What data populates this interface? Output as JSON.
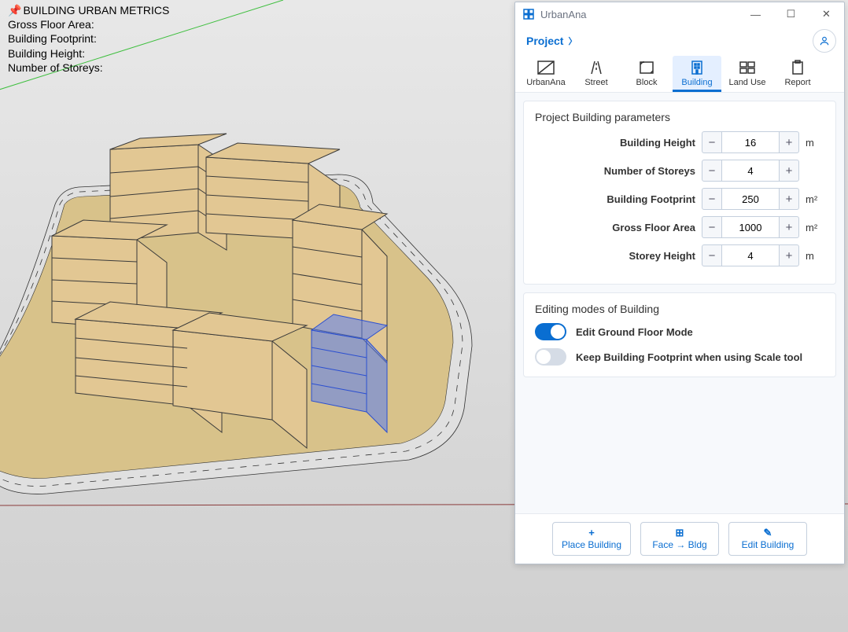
{
  "overlay": {
    "title": "BUILDING URBAN METRICS",
    "rows": [
      "Gross Floor Area:",
      "Building Footprint:",
      "Building Height:",
      "Number of Storeys:"
    ]
  },
  "panel": {
    "appName": "UrbanAna",
    "nav": {
      "project": "Project"
    },
    "tabs": [
      {
        "id": "urbanana",
        "label": "UrbanAna"
      },
      {
        "id": "street",
        "label": "Street"
      },
      {
        "id": "block",
        "label": "Block"
      },
      {
        "id": "building",
        "label": "Building",
        "active": true
      },
      {
        "id": "landuse",
        "label": "Land Use"
      },
      {
        "id": "report",
        "label": "Report"
      }
    ],
    "paramsTitle": "Project Building parameters",
    "params": {
      "buildingHeight": {
        "label": "Building Height",
        "value": "16",
        "unit": "m"
      },
      "numberOfStoreys": {
        "label": "Number of Storeys",
        "value": "4",
        "unit": ""
      },
      "buildingFootprint": {
        "label": "Building Footprint",
        "value": "250",
        "unit": "m²"
      },
      "grossFloorArea": {
        "label": "Gross Floor Area",
        "value": "1000",
        "unit": "m²"
      },
      "storeyHeight": {
        "label": "Storey Height",
        "value": "4",
        "unit": "m"
      }
    },
    "editModesTitle": "Editing modes of Building",
    "toggles": {
      "editGroundFloor": {
        "label": "Edit Ground Floor Mode",
        "on": true
      },
      "keepFootprint": {
        "label": "Keep Building Footprint when using Scale tool",
        "on": false
      }
    },
    "footer": {
      "place": "Place Building",
      "face": "Face → Bldg",
      "edit": "Edit Building"
    }
  }
}
